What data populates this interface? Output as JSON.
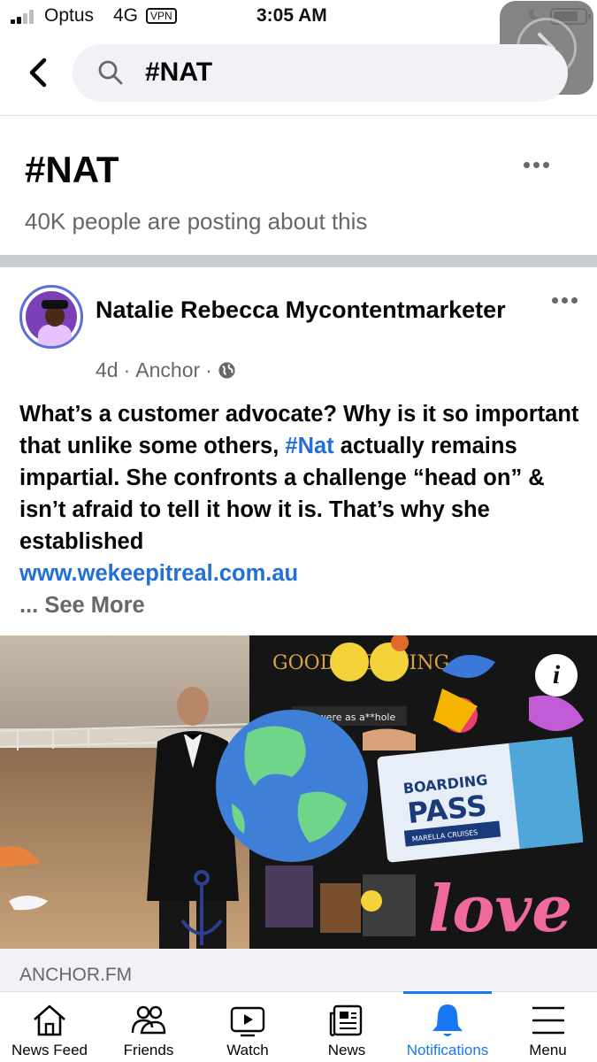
{
  "status_bar": {
    "carrier": "Optus",
    "network": "4G",
    "vpn_label": "VPN",
    "time": "3:05 AM",
    "battery_level": 0.8
  },
  "search": {
    "query": "#NAT"
  },
  "hashtag": {
    "title": "#NAT",
    "subtitle": "40K people are posting about this"
  },
  "post": {
    "author": "Natalie Rebecca Mycontentmarketer",
    "time": "4d",
    "separator": "·",
    "location": "Anchor",
    "text_part1": "What’s a customer advocate? Why is it so important that unlike some others, ",
    "hashtag_link": "#Nat",
    "text_part2": " actually remains impartial. She confronts a challenge “head on” & isn’t afraid to tell it how it is. That’s why she established",
    "link": "www.wekeepitreal.com.au",
    "see_more": "... See More",
    "image_texts": {
      "good_morning": "GOOD MORNING",
      "boarding": "BOARDING",
      "pass": "PASS",
      "cruises": "MARELLA CRUISES",
      "love": "love",
      "banner": "you were as a**hole"
    },
    "info_label": "i",
    "link_domain": "ANCHOR.FM"
  },
  "tabs": [
    {
      "label": "News Feed",
      "icon": "home-icon"
    },
    {
      "label": "Friends",
      "icon": "friends-icon"
    },
    {
      "label": "Watch",
      "icon": "watch-icon"
    },
    {
      "label": "News",
      "icon": "news-icon"
    },
    {
      "label": "Notifications",
      "icon": "bell-icon",
      "active": true
    },
    {
      "label": "Menu",
      "icon": "menu-icon"
    }
  ],
  "colors": {
    "accent": "#1877f2",
    "link": "#216fdb",
    "secondary_text": "#65676b"
  }
}
